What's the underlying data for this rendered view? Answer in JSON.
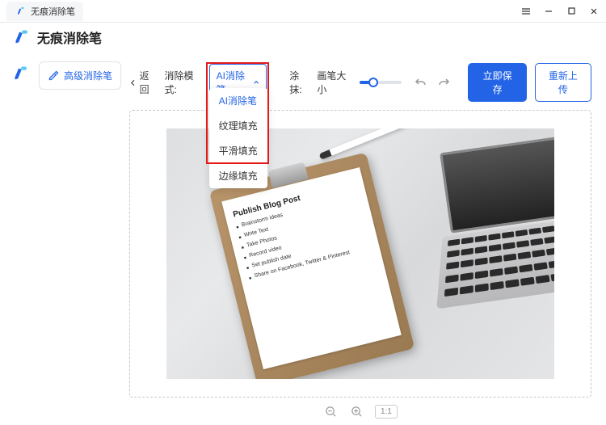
{
  "titlebar": {
    "tab_label": "无痕消除笔"
  },
  "header": {
    "app_title": "无痕消除笔"
  },
  "sidebar": {
    "advanced_remove_label": "高级消除笔"
  },
  "toolbar": {
    "back_label": "返回",
    "mode_label": "消除模式:",
    "mode_selected": "AI消除笔",
    "mode_options": [
      "AI消除笔",
      "纹理填充",
      "平滑填充",
      "边缘填充"
    ],
    "brush_label": "涂抹:",
    "brush_size_label": "画笔大小",
    "save_label": "立即保存",
    "reupload_label": "重新上传"
  },
  "canvas": {
    "paper_title": "Publish Blog Post",
    "paper_items": [
      "Brainstorm ideas",
      "Write Text",
      "Take Photos",
      "Record video",
      "Set publish date",
      "Share on Facebook, Twitter & Pinterest"
    ]
  },
  "zoom": {
    "ratio": "1:1"
  }
}
